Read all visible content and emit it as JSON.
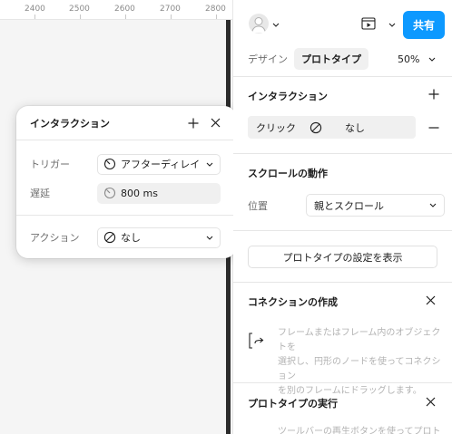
{
  "ruler": {
    "ticks": [
      "2400",
      "2500",
      "2600",
      "2700",
      "2800"
    ]
  },
  "popup": {
    "title": "インタラクション",
    "trigger_label": "トリガー",
    "trigger_value": "アフターディレイ",
    "delay_label": "遅延",
    "delay_value": "800 ms",
    "action_label": "アクション",
    "action_value": "なし"
  },
  "header": {
    "share_label": "共有"
  },
  "tabs": {
    "design": "デザイン",
    "prototype": "プロトタイプ",
    "zoom": "50%"
  },
  "interactions": {
    "title": "インタラクション",
    "row": {
      "trigger": "クリック",
      "action": "なし"
    }
  },
  "scroll": {
    "title": "スクロールの動作",
    "position_label": "位置",
    "position_value": "親とスクロール"
  },
  "settings_button": "プロトタイプの設定を表示",
  "connections": {
    "title": "コネクションの作成",
    "lines": [
      "フレームまたはフレーム内のオブジェクトを",
      "選択し、円形のノードを使ってコネクション",
      "を別のフレームにドラッグします。"
    ]
  },
  "run": {
    "title": "プロトタイプの実行",
    "text": "ツールバーの再生ボタンを使ってプロトタイ"
  },
  "colors": {
    "accent": "#0d99ff",
    "canvas": "#f5f5f5",
    "frame_edge": "#2c2c2c"
  }
}
